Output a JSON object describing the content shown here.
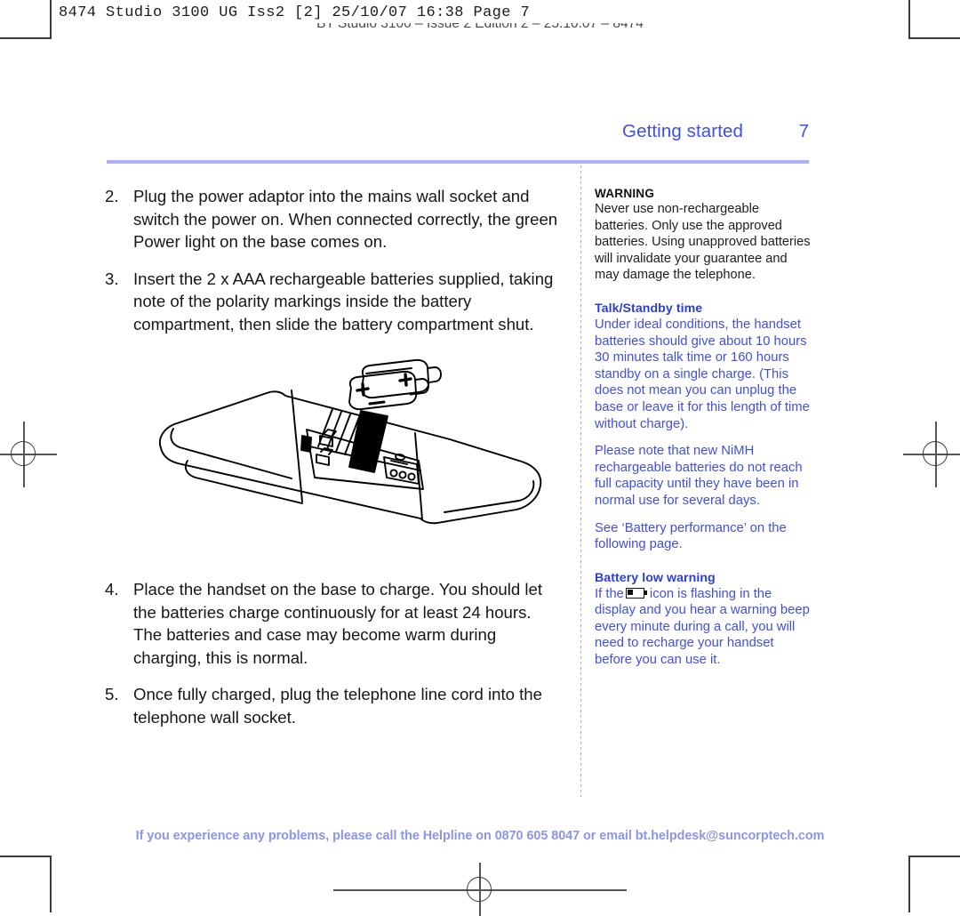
{
  "printer_marks": {
    "slug_mono": "8474 Studio 3100 UG Iss2 [2]  25/10/07  16:38  Page 7",
    "slug_center": "BT Studio 3100 – Issue 2 Edition 2 – 25.10.07 – 8474"
  },
  "header": {
    "title": "Getting started",
    "page_number": "7"
  },
  "main": {
    "steps": [
      {
        "number": "2.",
        "text": "Plug the power adaptor into the mains wall socket and switch the power on. When connected correctly, the green Power light on the base comes on."
      },
      {
        "number": "3.",
        "text": "Insert the 2 x AAA rechargeable batteries supplied, taking note of the polarity markings inside the battery compartment, then slide the battery compartment shut."
      }
    ],
    "steps_lower": [
      {
        "number": "4.",
        "text": "Place the handset on the base to charge. You should let the batteries charge continuously for at least 24 hours.",
        "text2": "The batteries and case may become warm during charging, this is normal."
      },
      {
        "number": "5.",
        "text": "Once fully charged, plug the telephone line cord into the telephone wall socket."
      }
    ],
    "illustration_caption": "handset-battery-compartment-diagram"
  },
  "sidebar": {
    "warning_heading": "WARNING",
    "warning_text": "Never use non-rechargeable batteries. Only use the approved batteries. Using unapproved batteries will invalidate your guarantee and may damage the telephone.",
    "talk_standby_heading": "Talk/Standby time",
    "talk_standby_text": "Under ideal conditions, the handset batteries should give about 10 hours 30 minutes talk time or 160 hours standby on a single charge. (This does not mean you can unplug the base or leave it for this length of time without charge).",
    "nimh_text": "Please note that new NiMH rechargeable batteries do not reach full capacity until they have been in normal use for several days.",
    "see_also_text": "See ‘Battery performance’ on the following page.",
    "battery_low_heading": "Battery low warning",
    "battery_low_text_before": "If the",
    "battery_low_text_after": "icon is flashing in the display and you hear a warning beep every minute during a call, you will need to recharge your handset before you can use it.",
    "battery_icon_name": "battery-low-icon"
  },
  "footer": {
    "text": "If you experience any problems, please call the Helpline on 0870 605 8047 or email bt.helpdesk@suncorptech.com"
  },
  "colors": {
    "brand_blue": "#3f4fe0",
    "rule_blue": "#a9b0f4",
    "body_blue": "#4050dd",
    "footer_blue": "#8b95ea",
    "text_black": "#161616"
  }
}
